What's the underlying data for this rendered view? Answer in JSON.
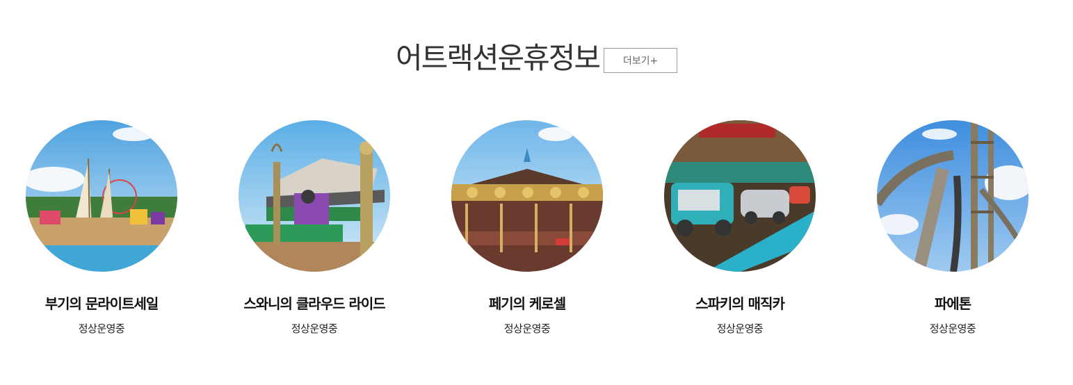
{
  "section": {
    "title": "어트랙션운휴정보",
    "more_label": "더보기+"
  },
  "attractions": [
    {
      "name": "부기의 문라이트세일",
      "status": "정상운영중"
    },
    {
      "name": "스와니의 클라우드 라이드",
      "status": "정상운영중"
    },
    {
      "name": "페기의 케로셀",
      "status": "정상운영중"
    },
    {
      "name": "스파키의 매직카",
      "status": "정상운영중"
    },
    {
      "name": "파에톤",
      "status": "정상운영중"
    }
  ]
}
